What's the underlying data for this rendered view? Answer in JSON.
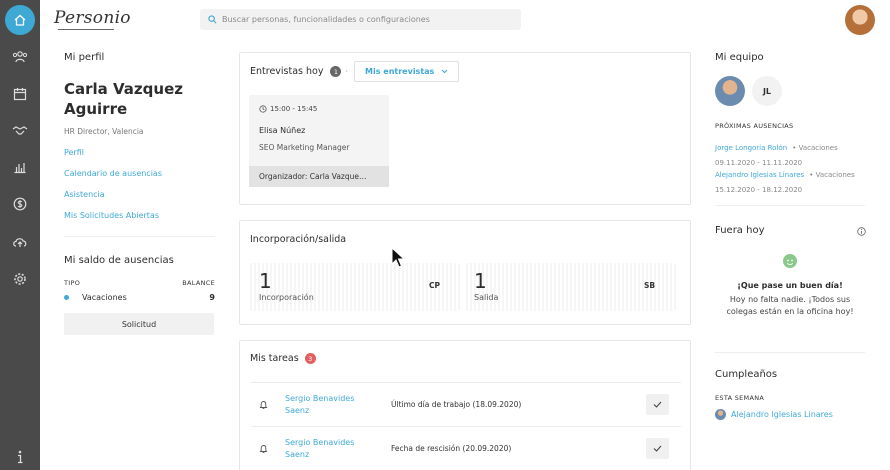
{
  "search": {
    "placeholder": "Buscar personas, funcionalidades o configuraciones"
  },
  "logo": "Personio",
  "profile": {
    "section_title": "Mi perfil",
    "name_line1": "Carla Vazquez",
    "name_line2": "Aguirre",
    "role": "HR Director, Valencia",
    "links": [
      "Perfil",
      "Calendario de ausencias",
      "Asistencia",
      "Mis Solicitudes Abiertas"
    ]
  },
  "balance": {
    "title": "Mi saldo de ausencias",
    "col_type": "TIPO",
    "col_balance": "BALANCE",
    "rows": [
      {
        "type": "Vacaciones",
        "balance": "9"
      }
    ],
    "button": "Solicitud"
  },
  "interviews": {
    "title": "Entrevistas hoy",
    "count": "1",
    "separator": "·",
    "filter": "Mis entrevistas",
    "card": {
      "time": "15:00 - 15:45",
      "name": "Elisa Núñez",
      "position": "SEO Marketing Manager",
      "organizer": "Organizador: Carla Vazque…"
    }
  },
  "onboarding": {
    "title": "Incorporación/salida",
    "stats": [
      {
        "value": "1",
        "label": "Incorporación",
        "badge": "CP"
      },
      {
        "value": "1",
        "label": "Salida",
        "badge": "SB"
      }
    ]
  },
  "tasks": {
    "title": "Mis tareas",
    "count": "3",
    "rows": [
      {
        "name": "Sergio Benavides Saenz",
        "desc": "Último día de trabajo (18.09.2020)"
      },
      {
        "name": "Sergio Benavides Saenz",
        "desc": "Fecha de rescisión (20.09.2020)"
      }
    ]
  },
  "team": {
    "title": "Mi equipo",
    "initials": "JL",
    "absences_title": "PRÓXIMAS AUSENCIAS",
    "absences": [
      {
        "name": "Jorge Longoria Rolón",
        "type": "• Vacaciones",
        "dates": "09.11.2020 - 11.11.2020"
      },
      {
        "name": "Alejandro Iglesias Linares",
        "type": "• Vacaciones",
        "dates": "15.12.2020 - 18.12.2020"
      }
    ]
  },
  "out_today": {
    "title": "Fuera hoy",
    "headline": "¡Que pase un buen día!",
    "body_line1": "Hoy no falta nadie. ¡Todos sus",
    "body_line2": "colegas están en la oficina hoy!"
  },
  "birthdays": {
    "title": "Cumpleaños",
    "week_label": "ESTA SEMANA",
    "person": "Alejandro Iglesias Linares"
  },
  "colors": {
    "accent": "#3fa9d6",
    "rail": "#4a4a4a",
    "badge_red": "#e06060"
  }
}
